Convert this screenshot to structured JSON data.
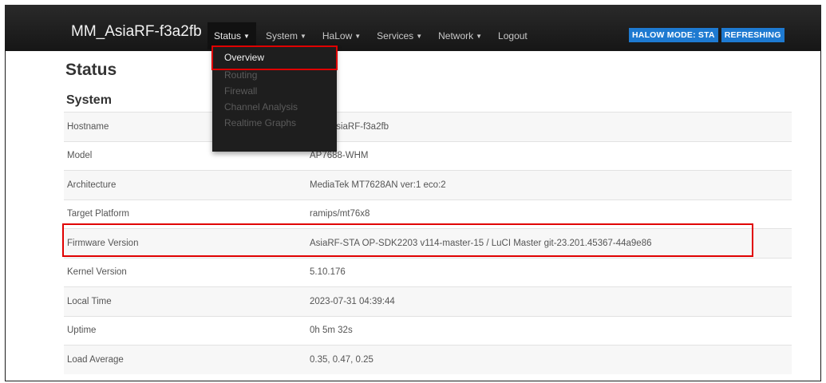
{
  "header": {
    "brand": "MM_AsiaRF-f3a2fb",
    "menu": [
      {
        "label": "Status"
      },
      {
        "label": "System"
      },
      {
        "label": "HaLow"
      },
      {
        "label": "Services"
      },
      {
        "label": "Network"
      },
      {
        "label": "Logout"
      }
    ],
    "caret": "▼",
    "badges": [
      "HALOW MODE: STA",
      "REFRESHING"
    ]
  },
  "dropdown": {
    "items": [
      "Overview",
      "Routing",
      "Firewall",
      "Channel Analysis",
      "Realtime Graphs"
    ],
    "selected_index": 0
  },
  "page": {
    "title": "Status",
    "section": "System"
  },
  "system_table": [
    {
      "key": "Hostname",
      "value": "MM_AsiaRF-f3a2fb"
    },
    {
      "key": "Model",
      "value": "AP7688-WHM"
    },
    {
      "key": "Architecture",
      "value": "MediaTek MT7628AN ver:1 eco:2"
    },
    {
      "key": "Target Platform",
      "value": "ramips/mt76x8"
    },
    {
      "key": "Firmware Version",
      "value": "AsiaRF-STA OP-SDK2203 v114-master-15 / LuCI Master git-23.201.45367-44a9e86"
    },
    {
      "key": "Kernel Version",
      "value": "5.10.176"
    },
    {
      "key": "Local Time",
      "value": "2023-07-31 04:39:44"
    },
    {
      "key": "Uptime",
      "value": "0h 5m 32s"
    },
    {
      "key": "Load Average",
      "value": "0.35, 0.47, 0.25"
    }
  ],
  "colors": {
    "navbar": "#1f1f1f",
    "badge": "#1e7ad1",
    "highlight": "#e00000"
  }
}
